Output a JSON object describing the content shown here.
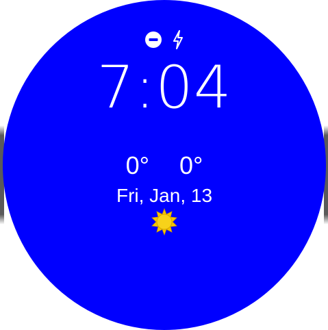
{
  "watchface": {
    "time": "7:04",
    "temperature_high": "0°",
    "temperature_low": "0°",
    "date": "Fri, Jan, 13",
    "weather_icon": "sun-icon",
    "status_icons": [
      "do-not-disturb-icon",
      "charging-icon"
    ],
    "colors": {
      "background": "#0000ff",
      "text": "#ffffff",
      "sun": "#f5c400"
    }
  }
}
